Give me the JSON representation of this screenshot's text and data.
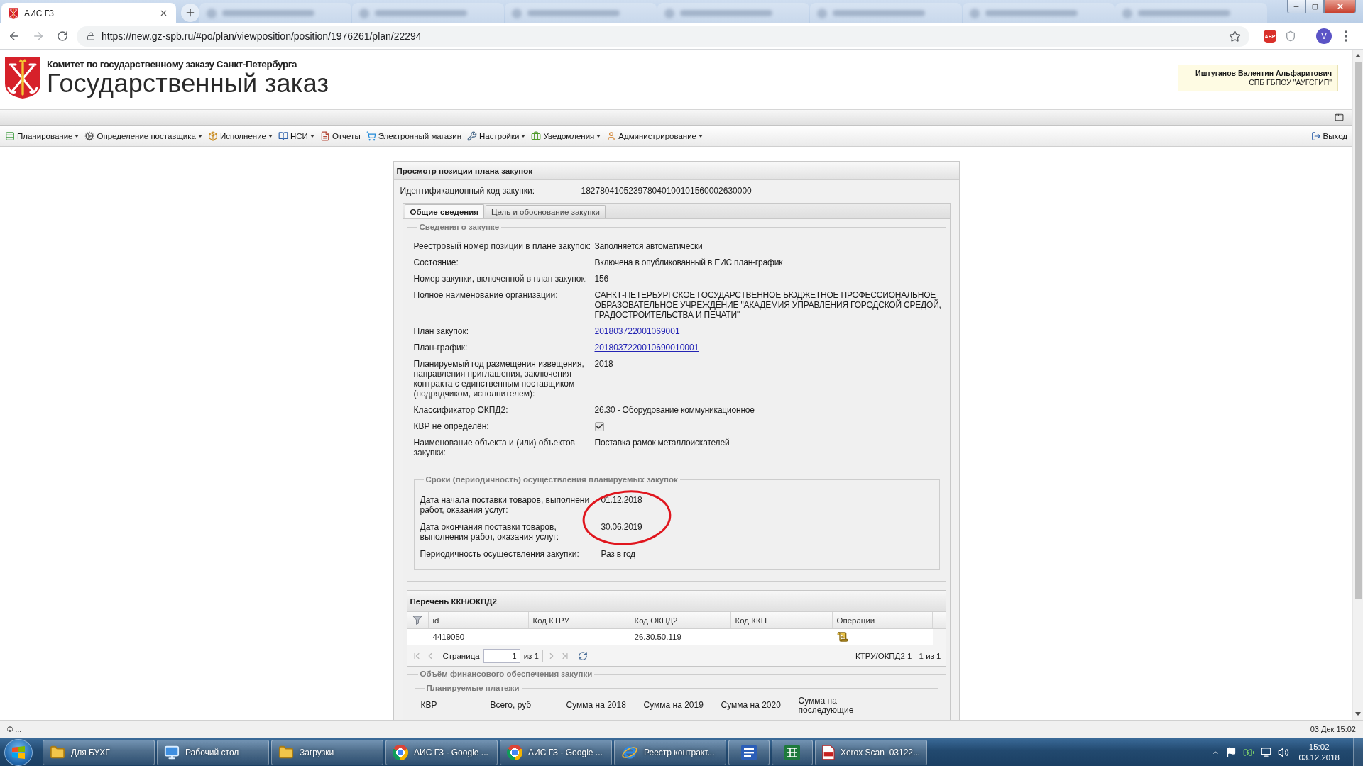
{
  "browser": {
    "tabs": [
      {
        "title": "АИС ГЗ",
        "selected": true
      },
      {
        "selected": false
      },
      {
        "selected": false
      },
      {
        "selected": false
      },
      {
        "selected": false
      },
      {
        "selected": false
      },
      {
        "selected": false
      },
      {
        "selected": false
      }
    ],
    "url": "https://new.gz-spb.ru/#po/plan/viewposition/position/1976261/plan/22294",
    "bookmarked": false,
    "extension_badge": "ABP",
    "profile_initial": "V"
  },
  "header": {
    "committee": "Комитет по государственному заказу Санкт-Петербурга",
    "title": "Государственный заказ",
    "user_name": "Иштуганов Валентин Альфаритович",
    "user_org": "СПБ ГБПОУ \"АУГСГИП\""
  },
  "menu": {
    "items": [
      {
        "label": "Планирование",
        "dropdown": true
      },
      {
        "label": "Определение поставщика",
        "dropdown": true
      },
      {
        "label": "Исполнение",
        "dropdown": true
      },
      {
        "label": "НСИ",
        "dropdown": true
      },
      {
        "label": "Отчеты",
        "dropdown": false
      },
      {
        "label": "Электронный магазин",
        "dropdown": false
      },
      {
        "label": "Настройки",
        "dropdown": true
      },
      {
        "label": "Уведомления",
        "dropdown": true
      },
      {
        "label": "Администрирование",
        "dropdown": true
      }
    ],
    "logout": "Выход"
  },
  "panel": {
    "title": "Просмотр позиции плана закупок",
    "code_label": "Идентификационный код закупки:",
    "code_value": "182780410523978040100101560002630000",
    "tabs": [
      {
        "label": "Общие сведения",
        "selected": true
      },
      {
        "label": "Цель и обоснование закупки",
        "selected": false
      }
    ],
    "details": {
      "legend": "Сведения о закупке",
      "fields": [
        {
          "kind": "text",
          "label": "Реестровый номер позиции в плане закупок:",
          "value": "Заполняется автоматически"
        },
        {
          "kind": "text",
          "label": "Состояние:",
          "value": "Включена в опубликованный в ЕИС план-график"
        },
        {
          "kind": "text",
          "label": "Номер закупки, включенной в план закупок:",
          "value": "156"
        },
        {
          "kind": "text",
          "label": "Полное наименование организации:",
          "value": "САНКТ-ПЕТЕРБУРГСКОЕ ГОСУДАРСТВЕННОЕ БЮДЖЕТНОЕ ПРОФЕССИОНАЛЬНОЕ ОБРАЗОВАТЕЛЬНОЕ УЧРЕЖДЕНИЕ \"АКАДЕМИЯ УПРАВЛЕНИЯ ГОРОДСКОЙ СРЕДОЙ, ГРАДОСТРОИТЕЛЬСТВА И ПЕЧАТИ\""
        },
        {
          "kind": "link",
          "label": "План закупок:",
          "value": "201803722001069001"
        },
        {
          "kind": "link",
          "label": "План-график:",
          "value": "2018037220010690010001"
        },
        {
          "kind": "text",
          "label": "Планируемый год размещения извещения, направления приглашения, заключения контракта с единственным поставщиком (подрядчиком, исполнителем):",
          "value": "2018"
        },
        {
          "kind": "text",
          "label": "Классификатор ОКПД2:",
          "value": "26.30 - Оборудование коммуникационное"
        },
        {
          "kind": "checkbox",
          "label": "КВР не определён:",
          "checked": true
        },
        {
          "kind": "text",
          "label": "Наименование объекта и (или) объектов закупки:",
          "value": "Поставка рамок металлоискателей"
        }
      ]
    },
    "terms": {
      "legend": "Сроки (периодичность) осуществления планируемых закупок",
      "annotation": {
        "kind": "ellipse"
      },
      "fields": [
        {
          "label": "Дата начала поставки товаров, выполнени работ, оказания услуг:",
          "value": "01.12.2018"
        },
        {
          "label": "Дата окончания поставки товаров, выполнения работ, оказания услуг:",
          "value": "30.06.2019"
        },
        {
          "label": "Периодичность осуществления закупки:",
          "value": "Раз в год"
        }
      ]
    },
    "codes": {
      "title": "Перечень ККН/ОКПД2",
      "columns": [
        "id",
        "Код КТРУ",
        "Код ОКПД2",
        "Код ККН",
        "Операции"
      ],
      "rows": [
        {
          "id": "4419050",
          "okpd2": "26.30.50.119"
        }
      ],
      "pager": {
        "page_label": "Страница",
        "page": "1",
        "page_count": "из 1",
        "summary": "КТРУ/ОКПД2 1 - 1 из 1"
      }
    },
    "finance": {
      "legend": "Объём финансового обеспечения закупки",
      "payments": {
        "legend": "Планируемые платежи",
        "columns": [
          "КВР",
          "Всего, руб",
          "Сумма на 2018",
          "Сумма на 2019",
          "Сумма на 2020",
          "Сумма на последующие"
        ]
      }
    }
  },
  "status_bar": {
    "left": "© ...",
    "right": "03 Дек 15:02"
  },
  "taskbar": {
    "items": [
      {
        "kind": "button",
        "label": "Для БУХГ"
      },
      {
        "kind": "button",
        "label": "Рабочий стол"
      },
      {
        "kind": "button",
        "label": "Загрузки"
      },
      {
        "kind": "button",
        "label": "АИС ГЗ - Google ..."
      },
      {
        "kind": "button",
        "label": "АИС ГЗ - Google ..."
      },
      {
        "kind": "button",
        "label": "Реестр контракт..."
      },
      {
        "kind": "icon"
      },
      {
        "kind": "icon"
      },
      {
        "kind": "button",
        "label": "Xerox Scan_03122..."
      }
    ],
    "time": "15:02",
    "date": "03.12.2018"
  }
}
